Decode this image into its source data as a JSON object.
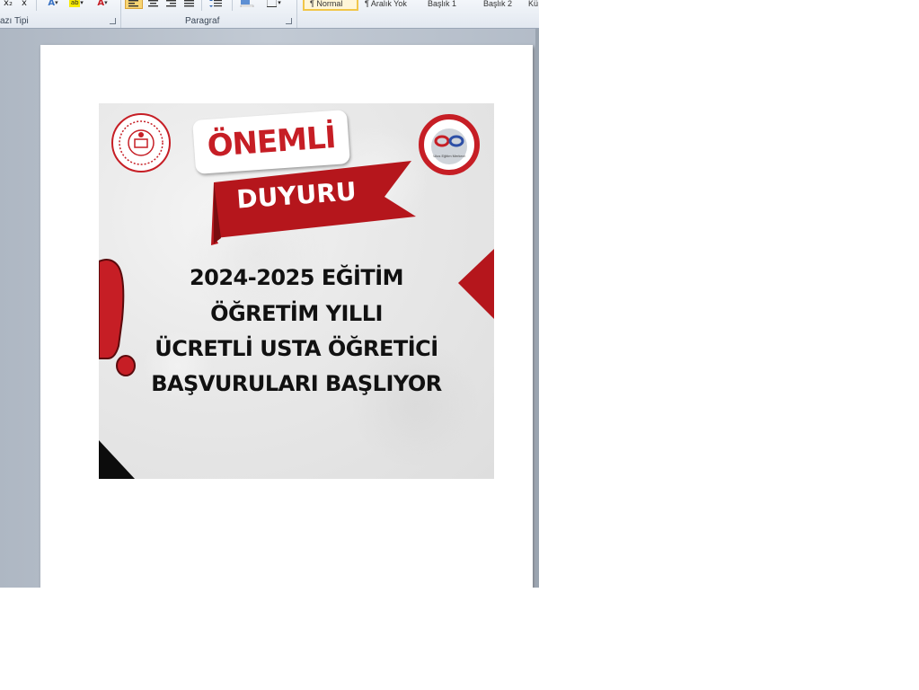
{
  "ribbon": {
    "groups": {
      "font_label": "azı Tipi",
      "paragraph_label": "Paragraf"
    },
    "buttons": {
      "subscript": "x₂",
      "clear_format": "x",
      "text_effects": "A",
      "highlight": "ab",
      "font_color": "A"
    },
    "styles": [
      "¶ Normal",
      "¶ Aralık Yok",
      "Başlık 1",
      "Başlık 2",
      "Kü"
    ]
  },
  "document": {
    "poster": {
      "badge_top": "ÖNEMLİ",
      "badge_bottom": "DUYURU",
      "lines": [
        "2024-2025  EĞİTİM",
        "ÖĞRETİM YILLI",
        "ÜCRETLİ USTA ÖĞRETİCİ",
        "BAŞVURULARI BAŞLIYOR"
      ],
      "logo_right_text": "Ulus Eğitim Merkezi"
    }
  },
  "colors": {
    "accent_red": "#c61e25",
    "ribbon_bg": "#e9eef5",
    "doc_bg": "#b9c1cc"
  }
}
